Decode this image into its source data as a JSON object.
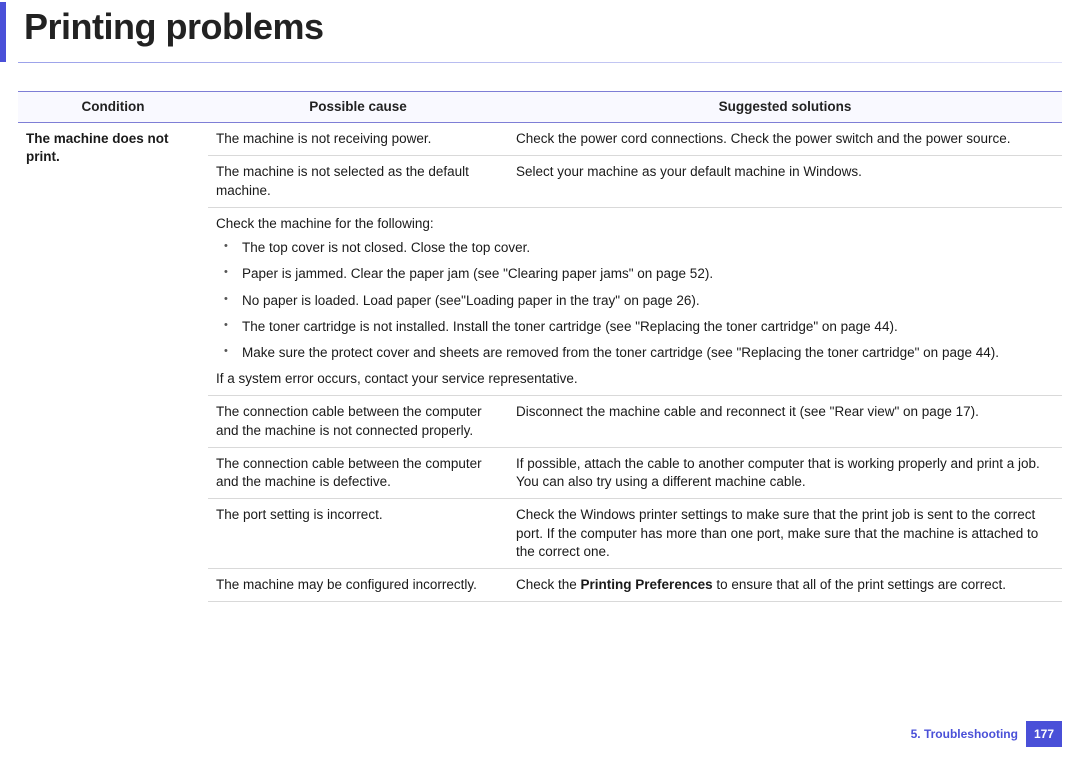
{
  "title": "Printing problems",
  "headers": {
    "condition": "Condition",
    "cause": "Possible cause",
    "solution": "Suggested solutions"
  },
  "condition": "The machine does not print.",
  "rows": {
    "r1": {
      "cause": "The machine is not receiving power.",
      "solution": "Check the power cord connections. Check the power switch and the power source."
    },
    "r2": {
      "cause": "The machine is not selected as the default machine.",
      "solution": "Select your machine as your default machine in Windows."
    },
    "check": {
      "intro": "Check the machine for the following:",
      "b1": "The top cover is not closed. Close the top cover.",
      "b2": "Paper is jammed. Clear the paper jam (see \"Clearing paper jams\" on page 52).",
      "b3": "No paper is loaded. Load paper (see\"Loading paper in the tray\" on page 26).",
      "b4": "The toner cartridge is not installed. Install the toner cartridge (see \"Replacing the toner cartridge\" on page 44).",
      "b5": "Make sure the protect cover and sheets are removed from the toner cartridge (see \"Replacing the toner cartridge\" on page 44).",
      "outro": "If a system error occurs, contact your service representative."
    },
    "r4": {
      "cause": "The connection cable between the computer and the machine is not connected properly.",
      "solution": "Disconnect the machine cable and reconnect it (see \"Rear view\" on page 17)."
    },
    "r5": {
      "cause": "The connection cable between the computer and the machine is defective.",
      "solution": "If possible, attach the cable to another computer that is working properly and print a job. You can also try using a different machine cable."
    },
    "r6": {
      "cause": "The port setting is incorrect.",
      "solution": "Check the Windows printer settings to make sure that the print job is sent to the correct port. If the computer has more than one port, make sure that the machine is attached to the correct one."
    },
    "r7": {
      "cause": "The machine may be configured incorrectly.",
      "solution_pre": "Check the ",
      "solution_bold": "Printing Preferences",
      "solution_post": " to ensure that all of the print settings are correct."
    }
  },
  "footer": {
    "chapter": "5.  Troubleshooting",
    "page": "177"
  }
}
